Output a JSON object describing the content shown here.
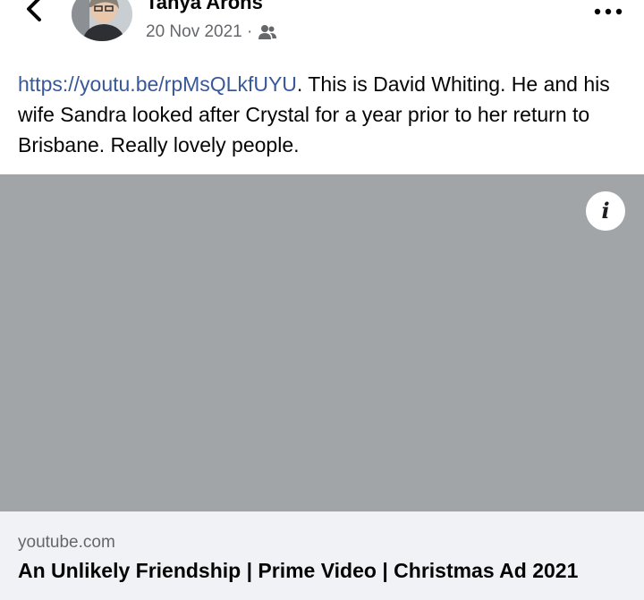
{
  "post": {
    "author": "Tanya Arons",
    "date": "20 Nov 2021 ·",
    "audience_icon": "friends-icon",
    "text": {
      "link": "https://youtu.be/rpMsQLkfUYU",
      "body": ". This is David Whiting.  He and his wife Sandra looked after Crystal for a year prior to her return to Brisbane.  Really lovely people."
    }
  },
  "link_preview": {
    "domain": "youtube.com",
    "title": "An Unlikely Friendship | Prime Video | Christmas Ad 2021"
  },
  "colors": {
    "link": "#385898",
    "media_placeholder": "#a2a5a8",
    "card_bg": "#f0f2f5",
    "secondary_text": "#65676b"
  }
}
